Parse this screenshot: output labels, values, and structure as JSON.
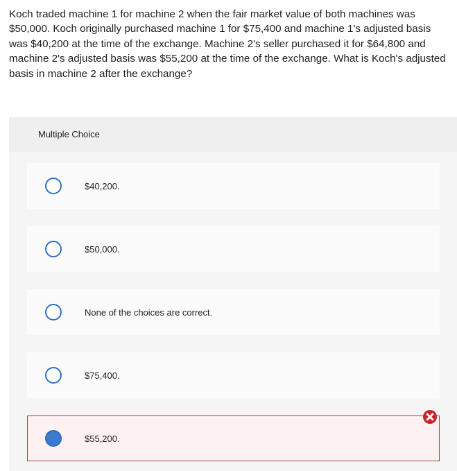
{
  "question": {
    "text": "Koch traded machine 1 for machine 2 when the fair market value of both machines was $50,000. Koch originally purchased machine 1 for $75,400 and machine 1's adjusted basis was $40,200 at the time of the exchange. Machine 2's seller purchased it for $64,800 and machine 2's adjusted basis was $55,200 at the time of the exchange. What is Koch's adjusted basis in machine 2 after the exchange?"
  },
  "panel": {
    "title": "Multiple Choice"
  },
  "choices": [
    {
      "label": "$40,200.",
      "selected": false
    },
    {
      "label": "$50,000.",
      "selected": false
    },
    {
      "label": "None of the choices are correct.",
      "selected": false
    },
    {
      "label": "$75,400.",
      "selected": false
    },
    {
      "label": "$55,200.",
      "selected": true,
      "status": "incorrect"
    }
  ],
  "colors": {
    "radio_border": "#2e6fc4",
    "radio_selected": "#3b7bd0",
    "incorrect_border": "#b33b3b",
    "incorrect_badge": "#c8232c"
  },
  "icons": {
    "incorrect": "close-x-icon"
  }
}
